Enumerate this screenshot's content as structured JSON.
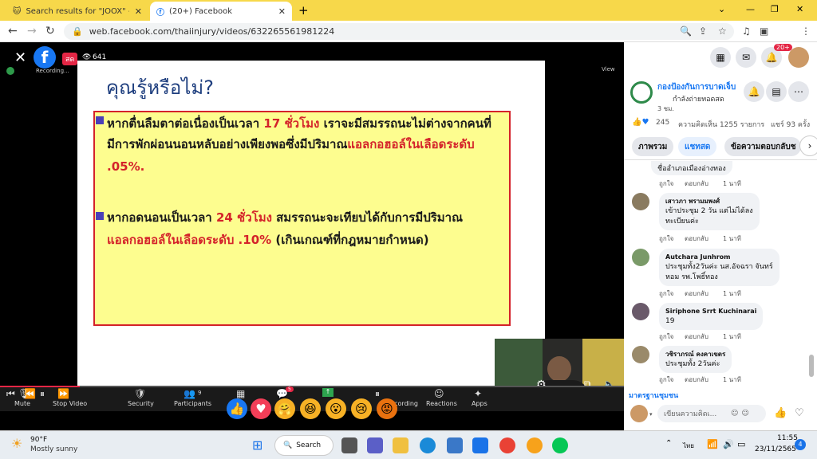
{
  "browser": {
    "tabs": [
      {
        "title": "Search results for \"JOOX\" - Thaila",
        "active": false
      },
      {
        "title": "(20+) Facebook",
        "active": true
      }
    ],
    "new_tab": "+",
    "url": "web.facebook.com/thaiinjury/videos/632265561981224",
    "window_controls": [
      "⌄",
      "—",
      "❐",
      "✕"
    ]
  },
  "video": {
    "live_badge": "สด",
    "viewers": "641",
    "recording": "Recording...",
    "view_label": "View",
    "slide_title": "คุณรู้หรือไม่?",
    "para1_a": "หากตื่นลืมตาต่อเนื่องเป็นเวลา ",
    "para1_b": "17 ชั่วโมง",
    "para1_c": " เราจะมีสมรรถนะไม่ต่างจากคนที่",
    "para1_line2a": "มีการพักผ่อนนอนหลับอย่างเพียงพอซึ่งมีปริมาณ",
    "para1_line2b": "แอลกอฮอล์ในเลือดระดับ",
    "para1_line3": ".05%.",
    "para2_a": "หากอดนอนเป็นเวลา ",
    "para2_b": "24 ชั่วโมง",
    "para2_c": " สมรรถนะจะเทียบได้กับการมีปริมาณ",
    "para2_line2a": "แอลกอฮอล์ในเลือดระดับ .10%",
    "para2_line2b": " (เกินเกณฑ์ที่กฎหมายกำหนด)",
    "zoom": {
      "mute": "Mute",
      "stop_video": "Stop Video",
      "security": "Security",
      "participants": "Participants",
      "participants_count": "9",
      "chat_count": "5",
      "recording": "Recording",
      "reactions": "Reactions",
      "apps": "Apps"
    }
  },
  "facebook": {
    "notif_badge": "20+",
    "page_name": "กองป้องกันการบาดเจ็บ",
    "page_status": "กำลังถ่ายทอดสด",
    "time": "3 ชม.",
    "reaction_count": "245",
    "comments_info": "ความคิดเห็น 1255 รายการ",
    "shares": "แชร์ 93 ครั้ง",
    "tabs": [
      "ภาพรวม",
      "แชทสด",
      "ข้อความตอบกลับช"
    ],
    "top_partial": "ชื่ออำเภอเมืองอ่างทอง",
    "comments": [
      {
        "name": "เสาวภา พรามมพงศ์",
        "text1": "เข้าประชุม 2 วัน แต่ไม่ได้ลง",
        "text2": "ทะเบียนค่ะ",
        "time": "1 นาที"
      },
      {
        "name": "Autchara Junhrom",
        "text1": "ประชุมทั้ง2วันค่ะ นส.อัจฉรา จันทร์",
        "text2": "หอม รพ.โพธิ์ทอง",
        "time": "1 นาที"
      },
      {
        "name": "Siriphone Srrt Kuchinarai",
        "text1": "19",
        "text2": "",
        "time": "1 นาที"
      },
      {
        "name": "วชิราภรณ์ คงคาเขตร",
        "text1": "ประชุมทั้ง 2วันค่ะ",
        "text2": "",
        "time": "1 นาที"
      }
    ],
    "like_label": "ถูกใจ",
    "reply_label": "ตอบกลับ",
    "first_time": "1 นาที",
    "community_link": "มาตรฐานชุมชน",
    "comment_placeholder": "เขียนความคิดเ..."
  },
  "taskbar": {
    "temp": "90°F",
    "weather": "Mostly sunny",
    "search": "Search",
    "lang": "ไทย",
    "time": "11:55",
    "date": "23/11/2565",
    "notif": "4"
  }
}
